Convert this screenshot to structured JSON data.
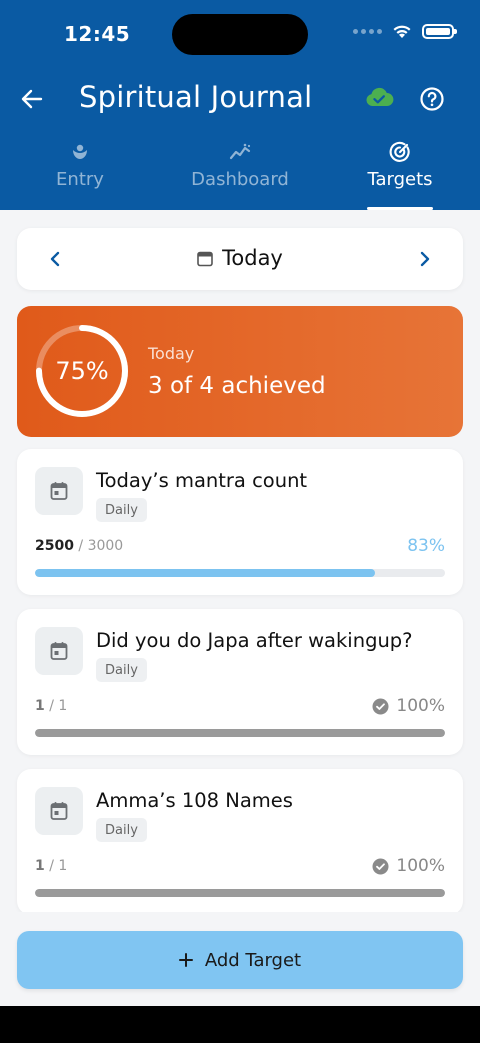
{
  "status": {
    "time": "12:45"
  },
  "header": {
    "title": "Spiritual Journal",
    "tabs": [
      {
        "label": "Entry",
        "icon": "lotus-icon",
        "active": false
      },
      {
        "label": "Dashboard",
        "icon": "chart-icon",
        "active": false
      },
      {
        "label": "Targets",
        "icon": "target-icon",
        "active": true
      }
    ]
  },
  "date_nav": {
    "label": "Today"
  },
  "summary": {
    "percent_label": "75%",
    "percent": 0.75,
    "day": "Today",
    "achieved": "3 of 4 achieved"
  },
  "targets": [
    {
      "title": "Today’s mantra count",
      "badge": "Daily",
      "current": "2500",
      "total": "/ 3000",
      "percent_label": "83%",
      "progress": 0.83,
      "complete": false,
      "bar_color": "#7cc3f0"
    },
    {
      "title": "Did you do Japa after wakingup?",
      "badge": "Daily",
      "current": "1",
      "total": "/ 1",
      "percent_label": "100%",
      "progress": 1.0,
      "complete": true,
      "bar_color": "#9a9a9a"
    },
    {
      "title": "Amma’s 108 Names",
      "badge": "Daily",
      "current": "1",
      "total": "/ 1",
      "percent_label": "100%",
      "progress": 1.0,
      "complete": true,
      "bar_color": "#9a9a9a"
    }
  ],
  "add_button": {
    "label": "Add Target"
  },
  "colors": {
    "header": "#0a5aa3",
    "summary_start": "#e05a1a",
    "summary_end": "#e77437",
    "cloud": "#4caf50",
    "accent_blue": "#7cc3f0"
  }
}
